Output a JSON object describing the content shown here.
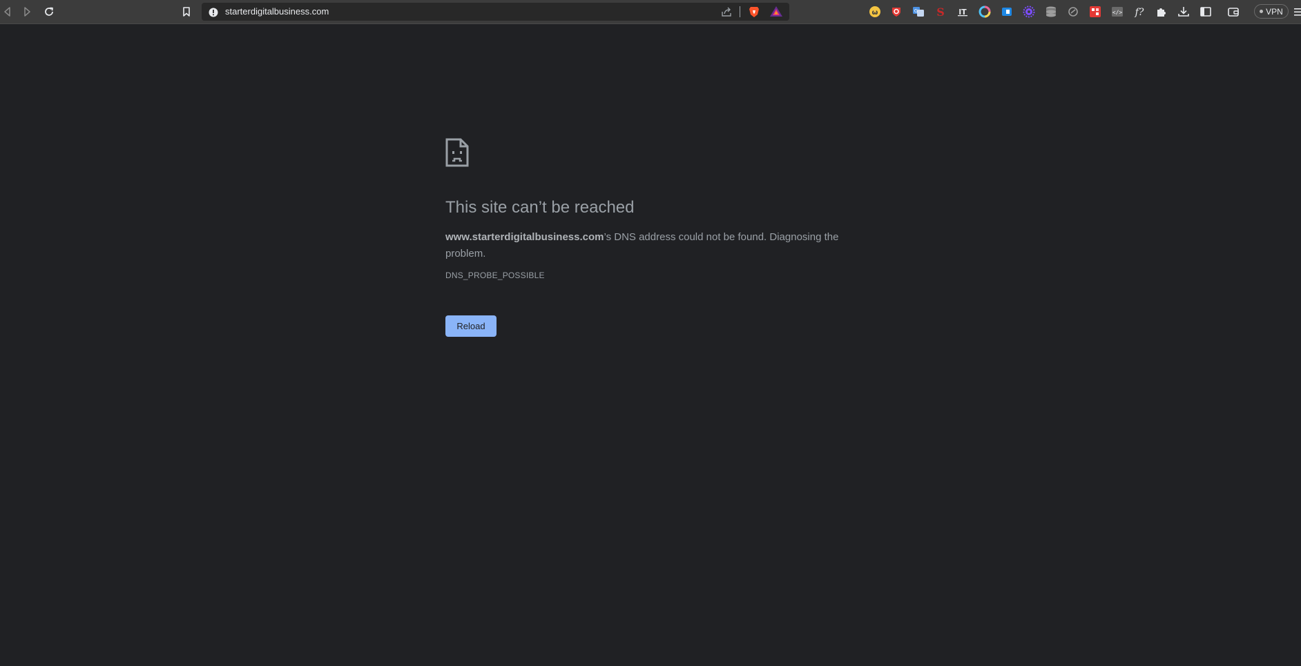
{
  "browser": {
    "url": "starterdigitalbusiness.com",
    "vpn_label": "VPN",
    "icons": {
      "back": "back-arrow-icon",
      "forward": "forward-arrow-icon",
      "reload": "reload-icon",
      "bookmark": "bookmark-icon",
      "site_info": "site-info-icon",
      "share": "share-icon",
      "brave_shields": "brave-shields-icon",
      "brave_rewards": "brave-rewards-icon",
      "menu": "menu-icon"
    },
    "extensions": [
      {
        "name": "yellow-w-extension-icon",
        "color": "#f5c542"
      },
      {
        "name": "red-shield-extension-icon",
        "color": "#e53935"
      },
      {
        "name": "translate-extension-icon",
        "color": "#4a90e2"
      },
      {
        "name": "red-s-extension-icon",
        "color": "#c62828"
      },
      {
        "name": "text-extension-icon",
        "color": "#e8eaed"
      },
      {
        "name": "color-wheel-extension-icon",
        "color": "#4fc3f7"
      },
      {
        "name": "blue-box-extension-icon",
        "color": "#1e88e5"
      },
      {
        "name": "purple-gear-extension-icon",
        "color": "#7c4dff"
      },
      {
        "name": "database-extension-icon",
        "color": "#9e9e9e"
      },
      {
        "name": "circle-extension-icon",
        "color": "#9e9e9e"
      },
      {
        "name": "red-grid-extension-icon",
        "color": "#e53935"
      },
      {
        "name": "code-extension-icon",
        "color": "#9e9e9e"
      },
      {
        "name": "function-extension-icon",
        "color": "#e8eaed"
      },
      {
        "name": "puzzle-extensions-icon",
        "color": "#e8eaed"
      },
      {
        "name": "download-icon",
        "color": "#e8eaed"
      },
      {
        "name": "sidebar-icon",
        "color": "#e8eaed"
      },
      {
        "name": "wallet-icon",
        "color": "#e8eaed"
      }
    ]
  },
  "error": {
    "icon": "sad-page-icon",
    "title": "This site can’t be reached",
    "host": "www.starterdigitalbusiness.com",
    "message": "’s DNS address could not be found. Diagnosing the problem.",
    "code": "DNS_PROBE_POSSIBLE",
    "reload_label": "Reload"
  },
  "colors": {
    "page_bg": "#202124",
    "toolbar_bg": "#3c3c3c",
    "button_bg": "#8ab4f8",
    "text": "#9aa0a6"
  }
}
